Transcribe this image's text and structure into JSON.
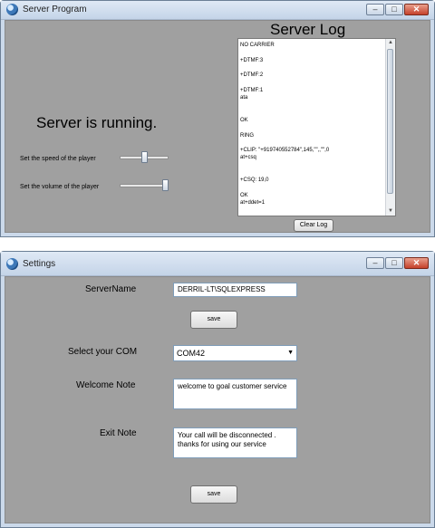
{
  "server_window": {
    "title": "Server Program",
    "status": "Server is running.",
    "speed_label": "Set the speed of the player",
    "speed_value": 0.5,
    "volume_label": "Set the volume of the player",
    "volume_value": 1.0,
    "log_title": "Server Log",
    "log_text": "NO CARRIER\n\n+DTMF:3\n\n+DTMF:2\n\n+DTMF:1\nata\n\n\nOK\n\nRING\n\n+CLIP: \"+919740552784\",145,\"\",,\"\",0\nat+csq\n\n\n+CSQ: 19,0\n\nOK\nat+ddet=1",
    "clear_button": "Clear Log",
    "min_btn": "–",
    "max_btn": "□",
    "close_btn": "✕"
  },
  "settings_window": {
    "title": "Settings",
    "server_name_label": "ServerName",
    "server_name_value": "DERRIL-LT\\SQLEXPRESS",
    "save_label": "save",
    "com_label": "Select your  COM",
    "com_value": "COM42",
    "welcome_label": "Welcome Note",
    "welcome_value": "welcome to goal customer service",
    "exit_label": "Exit Note",
    "exit_value": "Your call will be disconnected .\nthanks for using our service",
    "min_btn": "–",
    "max_btn": "□",
    "close_btn": "✕"
  },
  "colors": {
    "client_bg": "#a0a0a0",
    "close_red": "#c5412b",
    "frame": "#cbd9ea"
  }
}
